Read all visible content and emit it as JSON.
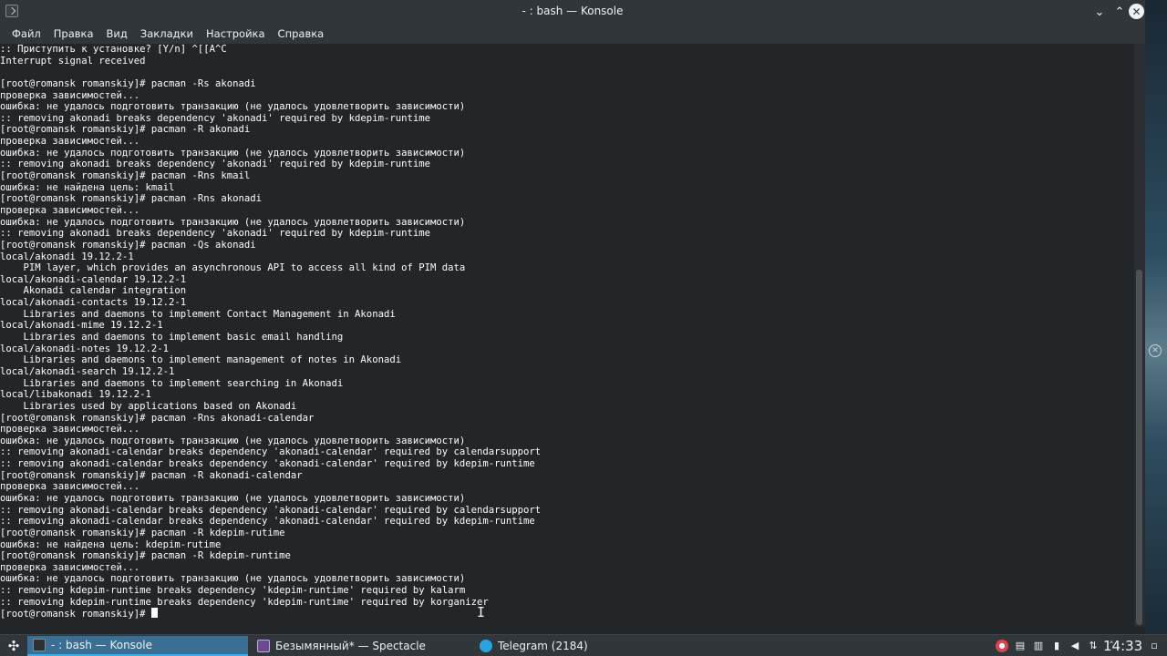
{
  "window": {
    "title": "- : bash — Konsole",
    "minimize_glyph": "⌄",
    "maximize_glyph": "⌃",
    "close_glyph": "✕"
  },
  "menu": [
    {
      "label": "Файл"
    },
    {
      "label": "Правка"
    },
    {
      "label": "Вид"
    },
    {
      "label": "Закладки"
    },
    {
      "label": "Настройка"
    },
    {
      "label": "Справка"
    }
  ],
  "terminal": {
    "lines": [
      ":: Приступить к установке? [Y/n] ^[[A^C",
      "Interrupt signal received",
      "",
      "[root@romansk romanskiy]# pacman -Rs akonadi",
      "проверка зависимостей...",
      "ошибка: не удалось подготовить транзакцию (не удалось удовлетворить зависимости)",
      ":: removing akonadi breaks dependency 'akonadi' required by kdepim-runtime",
      "[root@romansk romanskiy]# pacman -R akonadi",
      "проверка зависимостей...",
      "ошибка: не удалось подготовить транзакцию (не удалось удовлетворить зависимости)",
      ":: removing akonadi breaks dependency 'akonadi' required by kdepim-runtime",
      "[root@romansk romanskiy]# pacman -Rns kmail",
      "ошибка: не найдена цель: kmail",
      "[root@romansk romanskiy]# pacman -Rns akonadi",
      "проверка зависимостей...",
      "ошибка: не удалось подготовить транзакцию (не удалось удовлетворить зависимости)",
      ":: removing akonadi breaks dependency 'akonadi' required by kdepim-runtime",
      "[root@romansk romanskiy]# pacman -Qs akonadi",
      "local/akonadi 19.12.2-1",
      "    PIM layer, which provides an asynchronous API to access all kind of PIM data",
      "local/akonadi-calendar 19.12.2-1",
      "    Akonadi calendar integration",
      "local/akonadi-contacts 19.12.2-1",
      "    Libraries and daemons to implement Contact Management in Akonadi",
      "local/akonadi-mime 19.12.2-1",
      "    Libraries and daemons to implement basic email handling",
      "local/akonadi-notes 19.12.2-1",
      "    Libraries and daemons to implement management of notes in Akonadi",
      "local/akonadi-search 19.12.2-1",
      "    Libraries and daemons to implement searching in Akonadi",
      "local/libakonadi 19.12.2-1",
      "    Libraries used by applications based on Akonadi",
      "[root@romansk romanskiy]# pacman -Rns akonadi-calendar",
      "проверка зависимостей...",
      "ошибка: не удалось подготовить транзакцию (не удалось удовлетворить зависимости)",
      ":: removing akonadi-calendar breaks dependency 'akonadi-calendar' required by calendarsupport",
      ":: removing akonadi-calendar breaks dependency 'akonadi-calendar' required by kdepim-runtime",
      "[root@romansk romanskiy]# pacman -R akonadi-calendar",
      "проверка зависимостей...",
      "ошибка: не удалось подготовить транзакцию (не удалось удовлетворить зависимости)",
      ":: removing akonadi-calendar breaks dependency 'akonadi-calendar' required by calendarsupport",
      ":: removing akonadi-calendar breaks dependency 'akonadi-calendar' required by kdepim-runtime",
      "[root@romansk romanskiy]# pacman -R kdepim-rutime",
      "ошибка: не найдена цель: kdepim-rutime",
      "[root@romansk romanskiy]# pacman -R kdepim-runtime",
      "проверка зависимостей...",
      "ошибка: не удалось подготовить транзакцию (не удалось удовлетворить зависимости)",
      ":: removing kdepim-runtime breaks dependency 'kdepim-runtime' required by kalarm",
      ":: removing kdepim-runtime breaks dependency 'kdepim-runtime' required by korganizer"
    ],
    "prompt": "[root@romansk romanskiy]# "
  },
  "taskbar": {
    "launcher_glyph": "✣",
    "tasks": [
      {
        "label": "- : bash — Konsole",
        "active": true
      },
      {
        "label": "Безымянный* — Spectacle",
        "active": false
      },
      {
        "label": "Telegram (2184)",
        "active": false
      }
    ],
    "tray": {
      "icons": [
        "notification-icon",
        "clipboard-icon",
        "device-icon",
        "battery-icon",
        "volume-icon",
        "network-icon",
        "expand-icon"
      ],
      "glyphs": [
        "●",
        "▤",
        "▥",
        "▮",
        "◀",
        "⇅",
        "˄"
      ]
    },
    "clock": "14:33",
    "show_desktop_glyph": "▫"
  },
  "colors": {
    "terminal_bg": "#232629",
    "terminal_fg": "#fcfcfc",
    "chrome_bg": "#31363b",
    "active_task": "#3b6e93",
    "accent": "#3daee9"
  }
}
